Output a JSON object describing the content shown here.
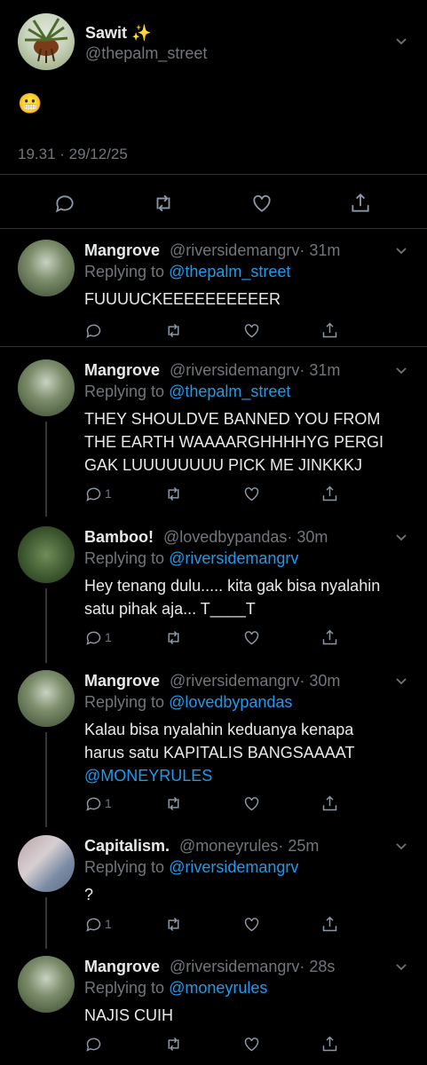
{
  "main_tweet": {
    "name": "Sawit ✨",
    "handle": "@thepalm_street",
    "text": "😬",
    "timestamp": "19.31 · 29/12/25"
  },
  "replies": [
    {
      "name": "Mangrove",
      "handle": "@riversidemangrv",
      "time": "· 31m",
      "replying_label": "Replying to",
      "replying_to": "@thepalm_street",
      "text": [
        "FUUUUCKEEEEEEEEEER"
      ],
      "reply_count": ""
    },
    {
      "name": "Mangrove",
      "handle": "@riversidemangrv",
      "time": "· 31m",
      "replying_label": "Replying to",
      "replying_to": "@thepalm_street",
      "text": [
        "THEY SHOULDVE BANNED YOU FROM",
        "THE EARTH WAAAARGHHHHYG PERGI",
        "GAK LUUUUUUUU PICK ME JINKKKJ"
      ],
      "reply_count": "1"
    },
    {
      "name": "Bamboo!",
      "handle": "@lovedbypandas",
      "time": "· 30m",
      "replying_label": "Replying to",
      "replying_to": "@riversidemangrv",
      "text": [
        "Hey tenang dulu..... kita gak bisa nyalahin",
        "satu pihak aja... T____T"
      ],
      "reply_count": "1"
    },
    {
      "name": "Mangrove",
      "handle": "@riversidemangrv",
      "time": "· 30m",
      "replying_label": "Replying to",
      "replying_to": "@lovedbypandas",
      "text": [
        "Kalau bisa nyalahin keduanya kenapa",
        "harus satu KAPITALIS BANGSAAAAT"
      ],
      "mention": "@MONEYRULES",
      "reply_count": "1"
    },
    {
      "name": "Capitalism.",
      "handle": "@moneyrules",
      "time": "· 25m",
      "replying_label": "Replying to",
      "replying_to": "@riversidemangrv",
      "text": [
        "?"
      ],
      "reply_count": "1"
    },
    {
      "name": "Mangrove",
      "handle": "@riversidemangrv",
      "time": "· 28s",
      "replying_label": "Replying to",
      "replying_to": "@moneyrules",
      "text": [
        "NAJIS CUIH"
      ],
      "reply_count": ""
    }
  ],
  "icons": [
    "chevron-down-icon",
    "reply-icon",
    "retweet-icon",
    "like-icon",
    "share-icon"
  ],
  "colors": {
    "background": "#000000",
    "text": "#e7e9ea",
    "muted": "#71767b",
    "link": "#1d9bf0",
    "separator": "#2f3336"
  }
}
